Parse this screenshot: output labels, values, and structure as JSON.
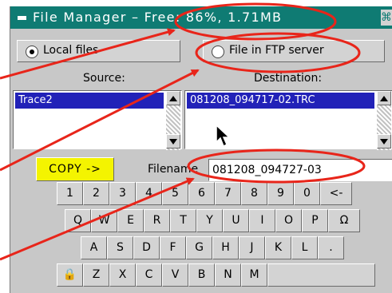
{
  "window": {
    "title": "File Manager – Free: 86%, 1.71MB",
    "close_glyph": "⌘"
  },
  "radios": {
    "local_label": "Local files",
    "ftp_label": "File in FTP server",
    "selected": "local"
  },
  "source": {
    "label": "Source:",
    "items": [
      "Trace2"
    ]
  },
  "destination": {
    "label": "Destination:",
    "items": [
      "081208_094717-02.TRC"
    ]
  },
  "copy_button": {
    "label": "COPY ->"
  },
  "filename": {
    "label": "Filename",
    "value": "081208_094727-03"
  },
  "keyboard": {
    "row1": [
      "1",
      "2",
      "3",
      "4",
      "5",
      "6",
      "7",
      "8",
      "9",
      "0",
      "<-"
    ],
    "row2": [
      "Q",
      "W",
      "E",
      "R",
      "T",
      "Y",
      "U",
      "I",
      "O",
      "P",
      "Ω"
    ],
    "row3": [
      "A",
      "S",
      "D",
      "F",
      "G",
      "H",
      "J",
      "K",
      "L",
      "."
    ],
    "row4": [
      "🔒",
      "Z",
      "X",
      "C",
      "V",
      "B",
      "N",
      "M",
      ""
    ]
  },
  "colors": {
    "titlebar": "#0f7b73",
    "highlight": "#e8251a",
    "copy_button": "#f4f400",
    "selection": "#2222b8"
  }
}
